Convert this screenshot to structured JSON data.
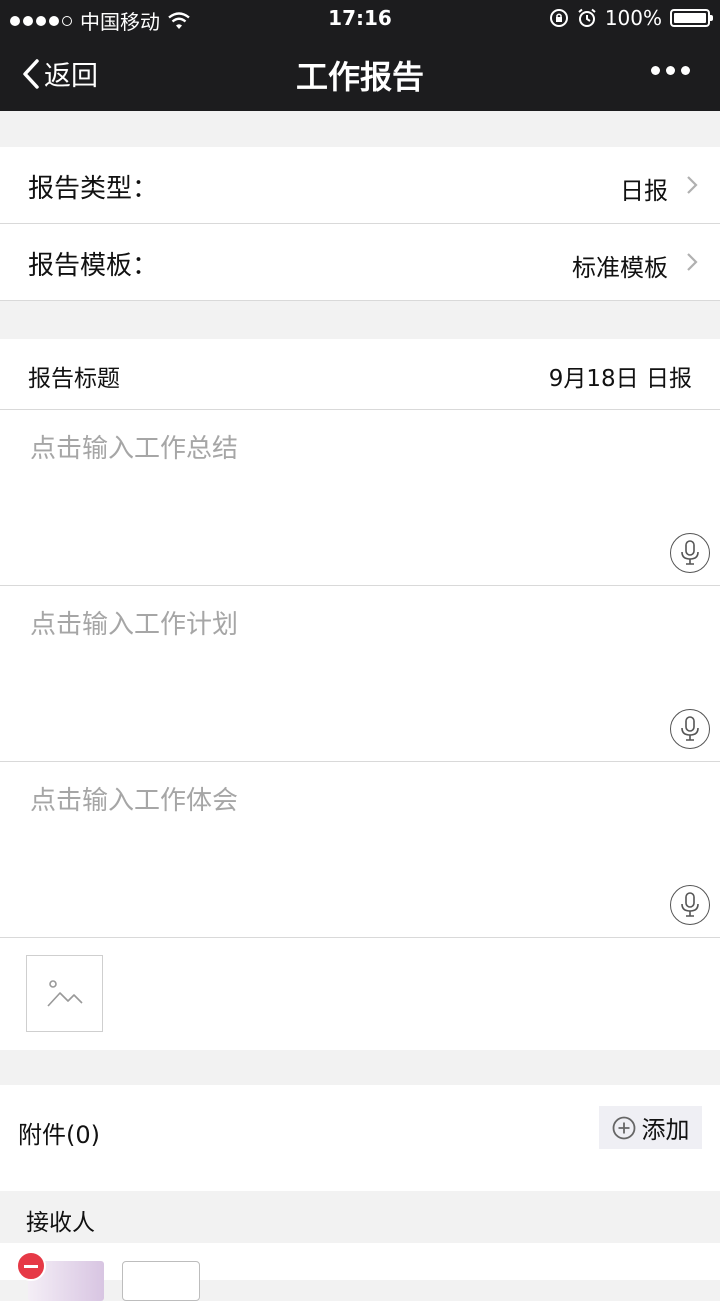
{
  "status_bar": {
    "carrier": "中国移动",
    "time": "17:16",
    "battery": "100%"
  },
  "navbar": {
    "back_label": "返回",
    "title": "工作报告"
  },
  "report_type": {
    "label": "报告类型：",
    "value": "日报"
  },
  "report_template": {
    "label": "报告模板：",
    "value": "标准模板"
  },
  "report_title": {
    "label": "报告标题",
    "value": "9月18日 日报"
  },
  "summary": {
    "placeholder": "点击输入工作总结"
  },
  "plan": {
    "placeholder": "点击输入工作计划"
  },
  "experience": {
    "placeholder": "点击输入工作体会"
  },
  "attachments": {
    "label": "附件(0)",
    "add_label": "添加"
  },
  "receivers": {
    "label": "接收人"
  }
}
